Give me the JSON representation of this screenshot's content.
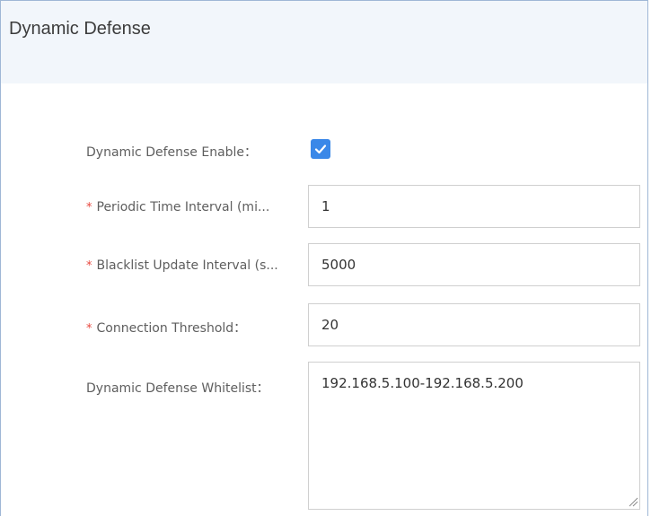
{
  "section": {
    "title": "Dynamic Defense"
  },
  "form": {
    "enable": {
      "label": "Dynamic Defense Enable：",
      "checked": true
    },
    "periodic_interval": {
      "required_mark": "*",
      "label": "Periodic Time Interval (mi...",
      "value": "1"
    },
    "blacklist_interval": {
      "required_mark": "*",
      "label": "Blacklist Update Interval (s...",
      "value": "5000"
    },
    "connection_threshold": {
      "required_mark": "*",
      "label": "Connection Threshold：",
      "value": "20"
    },
    "whitelist": {
      "label": "Dynamic Defense Whitelist：",
      "value": "192.168.5.100-192.168.5.200"
    }
  },
  "colors": {
    "accent": "#3a88e8",
    "required": "#e8483f",
    "header_bg": "#f2f6fb",
    "panel_border": "#9fb7d6"
  },
  "icons": {
    "checkbox": "check-icon",
    "resize": "resize-grip-icon"
  }
}
